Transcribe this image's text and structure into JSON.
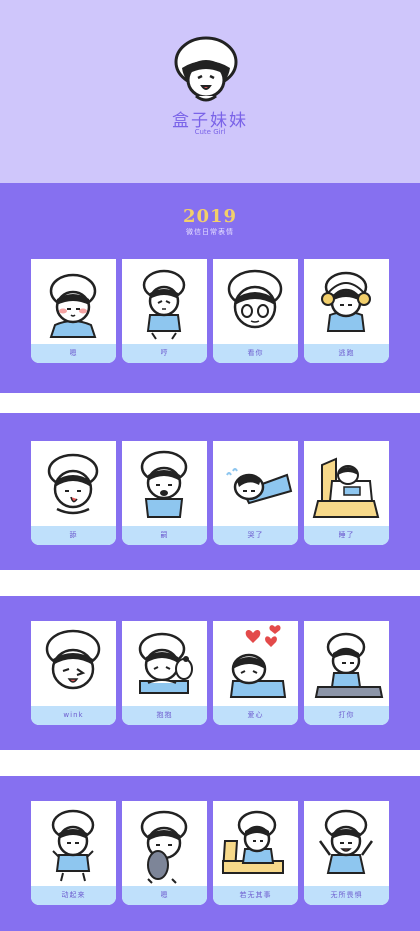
{
  "header": {
    "title": "盒子妹妹",
    "subtitle": "Cute Girl"
  },
  "section": {
    "year": "2019",
    "subtitle": "微信日常表情"
  },
  "stickers": [
    {
      "label": "嗯"
    },
    {
      "label": "哼"
    },
    {
      "label": "看你"
    },
    {
      "label": "逃跑"
    },
    {
      "label": "舔"
    },
    {
      "label": "嗣"
    },
    {
      "label": "哭了"
    },
    {
      "label": "睡了"
    },
    {
      "label": "wink"
    },
    {
      "label": "抱抱"
    },
    {
      "label": "爱心"
    },
    {
      "label": "打你"
    },
    {
      "label": "动起来"
    },
    {
      "label": "嗯"
    },
    {
      "label": "若无其事"
    },
    {
      "label": "无所畏惧"
    }
  ],
  "colors": {
    "header_bg": "#cfc6fb",
    "band_bg": "#8670f0",
    "caption_bg": "#bfe0fb",
    "year": "#f2cf6b",
    "text_purple": "#7a63e8"
  }
}
